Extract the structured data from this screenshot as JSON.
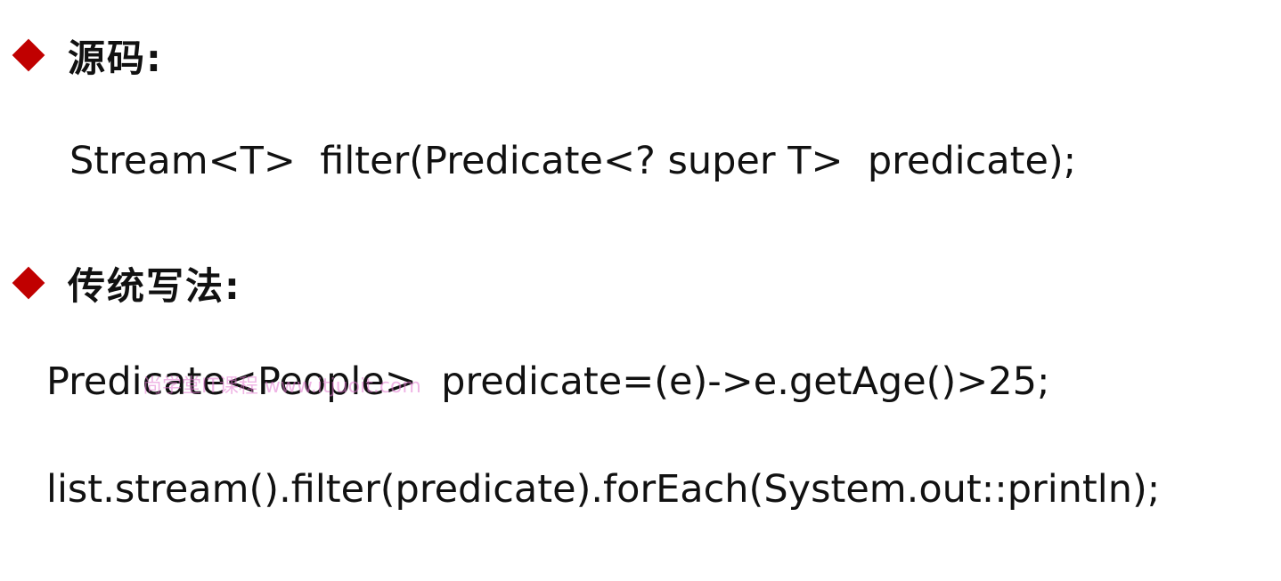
{
  "sections": [
    {
      "heading": "源码:",
      "lines": [
        "Stream<T>  filter(Predicate<? super T>  predicate);"
      ]
    },
    {
      "heading": "传统写法:",
      "lines": [
        "Predicate<People>  predicate=(e)->e.getAge()>25;",
        "list.stream().filter(predicate).forEach(System.out::println);"
      ]
    }
  ],
  "watermark": "尚学堂IT课程 www.itjuoit.com",
  "colors": {
    "bullet": "#c00000",
    "text": "#111111",
    "watermark": "#e27ad0"
  }
}
